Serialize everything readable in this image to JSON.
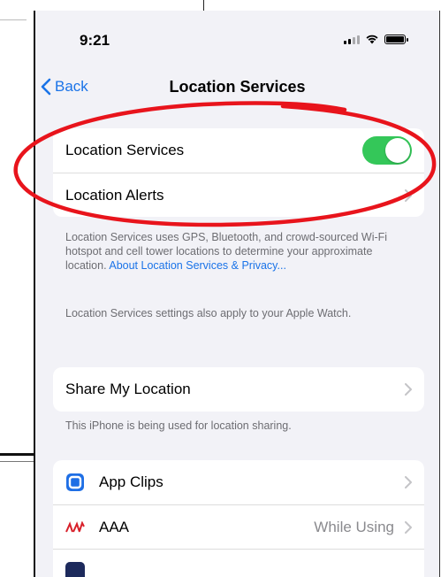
{
  "status_bar": {
    "time": "9:21"
  },
  "nav": {
    "back_label": "Back",
    "title": "Location Services"
  },
  "location_group": {
    "toggle_label": "Location Services",
    "toggle_on": true,
    "alerts_label": "Location Alerts"
  },
  "description": {
    "text": "Location Services uses GPS, Bluetooth, and crowd-sourced Wi-Fi hotspot and cell tower locations to determine your approximate location.",
    "link": "About Location Services & Privacy...",
    "watch_note": "Location Services settings also apply to your Apple Watch."
  },
  "share_group": {
    "label": "Share My Location",
    "note": "This iPhone is being used for location sharing."
  },
  "apps": [
    {
      "name": "App Clips",
      "value": "",
      "icon": "app-clips-icon"
    },
    {
      "name": "AAA",
      "value": "While Using",
      "icon": "aaa-logo-icon"
    },
    {
      "name": "",
      "value": "",
      "icon": "app-icon-partial"
    }
  ],
  "colors": {
    "accent": "#1a73e8",
    "toggle_on": "#34c759",
    "annotation": "#e8141c"
  }
}
